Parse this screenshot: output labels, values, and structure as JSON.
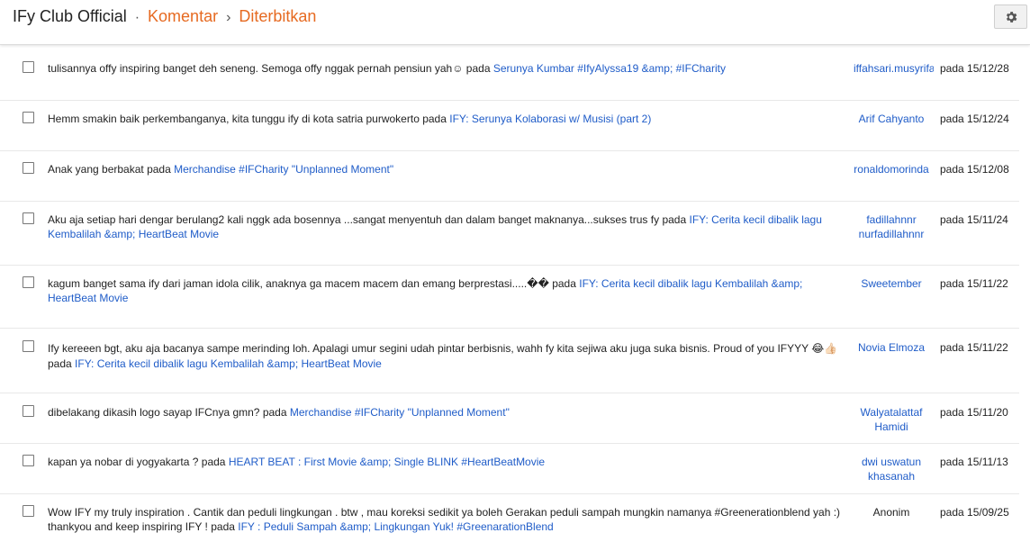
{
  "header": {
    "blog_title": "IFy Club Official",
    "separator": "·",
    "section": "Komentar",
    "chevron": "›",
    "subsection": "Diterbitkan",
    "settings_icon": "gear-icon"
  },
  "colors": {
    "breadcrumb_accent": "#e66a21",
    "link": "#1f5cc8"
  },
  "comments": [
    {
      "text": "tulisannya offy inspiring banget deh seneng. Semoga offy nggak pernah pensiun yah☺",
      "pada": " pada ",
      "post": "Serunya Kumbar #IfyAlyssa19 &amp; #IFCharity",
      "author": "iffahsari.musyrifah",
      "date": "pada 15/12/28"
    },
    {
      "text": "Hemm smakin baik perkembanganya, kita tunggu ify di kota satria purwokerto",
      "pada": " pada ",
      "post": "IFY: Serunya Kolaborasi w/ Musisi (part 2)",
      "author": "Arif Cahyanto",
      "date": "pada 15/12/24"
    },
    {
      "text": "Anak yang berbakat",
      "pada": " pada ",
      "post": "Merchandise #IFCharity \"Unplanned Moment\"",
      "author": "ronaldomorinda",
      "date": "pada 15/12/08"
    },
    {
      "text": "Aku aja setiap hari dengar berulang2 kali nggk ada bosennya ...sangat menyentuh dan dalam banget maknanya...sukses trus fy",
      "pada": " pada ",
      "post": "IFY: Cerita kecil dibalik lagu Kembalilah &amp; HeartBeat Movie",
      "author": "fadillahnnr nurfadillahnnr",
      "date": "pada 15/11/24"
    },
    {
      "text": "kagum banget sama ify dari jaman idola cilik, anaknya ga macem macem dan emang berprestasi.....��",
      "pada": " pada ",
      "post": "IFY: Cerita kecil dibalik lagu Kembalilah &amp; HeartBeat Movie",
      "author": "Sweetember",
      "date": "pada 15/11/22"
    },
    {
      "text": "Ify kereeen bgt, aku aja bacanya sampe merinding loh. Apalagi umur segini udah pintar berbisnis, wahh fy kita sejiwa aku juga suka bisnis. Proud of you IFYYY 😂👍🏻",
      "pada": " pada ",
      "post": "IFY: Cerita kecil dibalik lagu Kembalilah &amp; HeartBeat Movie",
      "author": "Novia Elmoza",
      "date": "pada 15/11/22"
    },
    {
      "text": "dibelakang dikasih logo sayap IFCnya gmn?",
      "pada": " pada ",
      "post": "Merchandise #IFCharity \"Unplanned Moment\"",
      "author": "Walyatalattaf Hamidi",
      "date": "pada 15/11/20"
    },
    {
      "text": "kapan ya nobar di yogyakarta ?",
      "pada": " pada ",
      "post": "HEART BEAT : First Movie &amp; Single BLINK #HeartBeatMovie",
      "author": "dwi uswatun khasanah",
      "date": "pada 15/11/13"
    },
    {
      "text": "Wow IFY my truly inspiration . Cantik dan peduli lingkungan . btw , mau koreksi sedikit ya boleh Gerakan peduli sampah mungkin namanya #Greenerationblend yah :) thankyou and keep inspiring IFY !",
      "pada": " pada ",
      "post": "IFY : Peduli Sampah &amp; Lingkungan Yuk! #GreenarationBlend",
      "author": "Anonim",
      "date": "pada 15/09/25"
    }
  ]
}
